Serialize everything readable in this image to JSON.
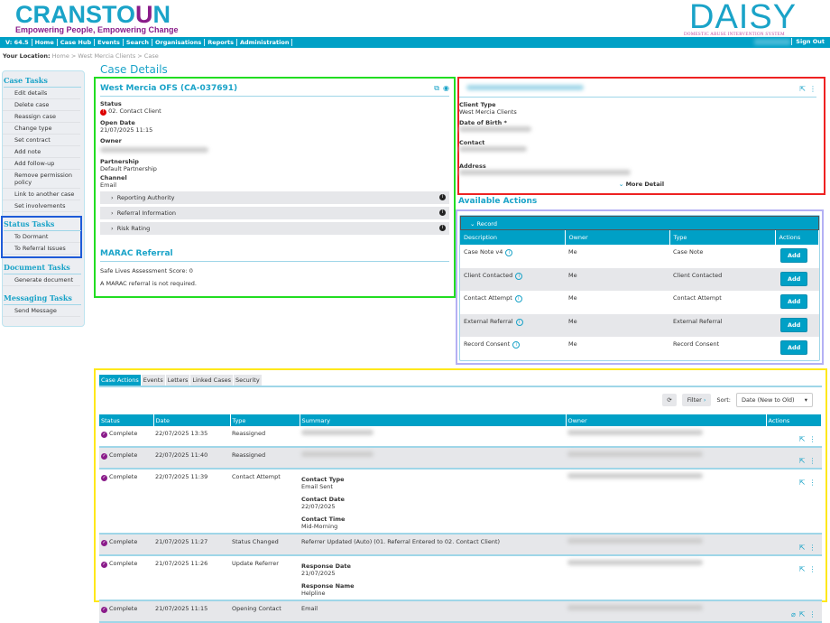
{
  "brand": {
    "name_start": "CRANSTO",
    "name_u": "U",
    "name_end": "N",
    "tagline": "Empowering People, Empowering Change",
    "app_logo": "DAISY",
    "app_logo_sub": "DOMESTIC ABUSE INTERVENTION SYSTEM"
  },
  "nav": {
    "version": "V: 64.5",
    "items": [
      "Home",
      "Case Hub",
      "Events",
      "Search",
      "Organisations",
      "Reports",
      "Administration"
    ],
    "sign_out": "Sign Out"
  },
  "location": {
    "label": "Your Location:",
    "path": "Home > West Mercia Clients > Case"
  },
  "sidebar": {
    "case_tasks": {
      "title": "Case Tasks",
      "items": [
        "Edit details",
        "Delete case",
        "Reassign case",
        "Change type",
        "Set contract",
        "Add note",
        "Add follow-up",
        "Remove permission policy",
        "Link to another case",
        "Set involvements"
      ]
    },
    "status_tasks": {
      "title": "Status Tasks",
      "items": [
        "To Dormant",
        "To Referral Issues"
      ]
    },
    "document_tasks": {
      "title": "Document Tasks",
      "items": [
        "Generate document"
      ]
    },
    "messaging_tasks": {
      "title": "Messaging Tasks",
      "items": [
        "Send Message"
      ]
    }
  },
  "page_title": "Case Details",
  "case": {
    "title": "West Mercia OFS (CA-037691)",
    "status_label": "Status",
    "status": "02. Contact Client",
    "open_date_label": "Open Date",
    "open_date": "21/07/2025 11:15",
    "owner_label": "Owner",
    "partnership_label": "Partnership",
    "partnership": "Default Partnership",
    "channel_label": "Channel",
    "channel": "Email",
    "sections": [
      "Reporting Authority",
      "Referral Information",
      "Risk Rating"
    ],
    "marac_title": "MARAC Referral",
    "marac_score": "Safe Lives Assessment Score: 0",
    "marac_note": "A MARAC referral is not required."
  },
  "client": {
    "client_type_label": "Client Type",
    "client_type": "West Mercia Clients",
    "dob_label": "Date of Birth *",
    "contact_label": "Contact",
    "address_label": "Address",
    "more": "More Detail"
  },
  "actions": {
    "title": "Available Actions",
    "group": "Record",
    "columns": [
      "Description",
      "Owner",
      "Type",
      "Actions"
    ],
    "add_label": "Add",
    "rows": [
      {
        "desc": "Case Note v4",
        "owner": "Me",
        "type": "Case Note"
      },
      {
        "desc": "Client Contacted",
        "owner": "Me",
        "type": "Client Contacted"
      },
      {
        "desc": "Contact Attempt",
        "owner": "Me",
        "type": "Contact Attempt"
      },
      {
        "desc": "External Referral",
        "owner": "Me",
        "type": "External Referral"
      },
      {
        "desc": "Record Consent",
        "owner": "Me",
        "type": "Record Consent"
      }
    ]
  },
  "case_actions": {
    "tabs": [
      "Case Actions",
      "Events",
      "Letters",
      "Linked Cases",
      "Security"
    ],
    "filter": "Filter",
    "sort_label": "Sort:",
    "sort_value": "Date (New to Old)",
    "columns": [
      "Status",
      "Date",
      "Type",
      "Summary",
      "Owner",
      "Actions"
    ],
    "rows": [
      {
        "status": "Complete",
        "date": "22/07/2025 13:35",
        "type": "Reassigned",
        "summary": []
      },
      {
        "status": "Complete",
        "date": "22/07/2025 11:40",
        "type": "Reassigned",
        "summary": []
      },
      {
        "status": "Complete",
        "date": "22/07/2025 11:39",
        "type": "Contact Attempt",
        "summary": [
          {
            "k": "Contact Type",
            "v": "Email Sent"
          },
          {
            "k": "Contact Date",
            "v": "22/07/2025"
          },
          {
            "k": "Contact Time",
            "v": "Mid-Morning"
          }
        ]
      },
      {
        "status": "Complete",
        "date": "21/07/2025 11:27",
        "type": "Status Changed",
        "text": "Referrer Updated (Auto) (01. Referral Entered to 02. Contact Client)",
        "summary": []
      },
      {
        "status": "Complete",
        "date": "21/07/2025 11:26",
        "type": "Update Referrer",
        "summary": [
          {
            "k": "Response Date",
            "v": "21/07/2025"
          },
          {
            "k": "Response Name",
            "v": "Helpline"
          }
        ]
      },
      {
        "status": "Complete",
        "date": "21/07/2025 11:15",
        "type": "Opening Contact",
        "text": "Email",
        "summary": [],
        "attachment": true
      }
    ]
  },
  "colors": {
    "brand": "#1aa3c8",
    "nav": "#00a0c6",
    "accent_purple": "#8a1c8a"
  }
}
